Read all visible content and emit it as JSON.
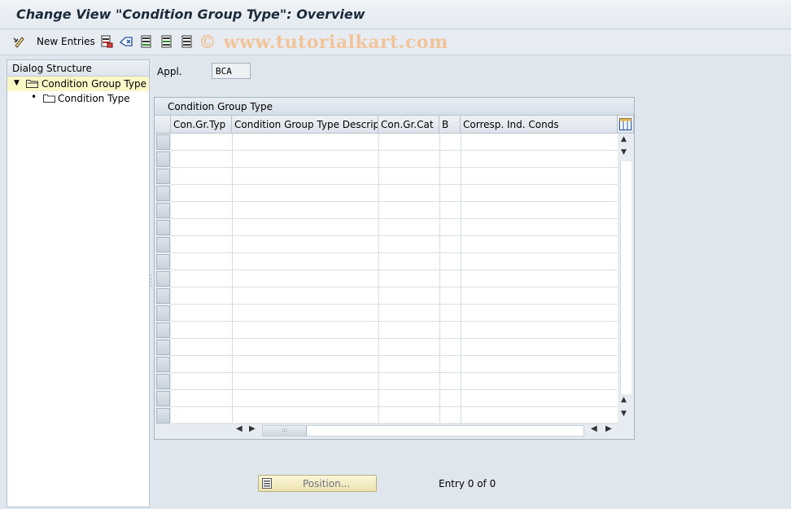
{
  "window": {
    "title": "Change View \"Condition Group Type\": Overview"
  },
  "toolbar": {
    "new_entries_label": "New Entries",
    "watermark": "© www.tutorialkart.com",
    "icons": [
      "change-display-icon",
      "new-entries-icon",
      "copy-as-icon",
      "delete-icon",
      "undo-change-icon",
      "select-all-icon",
      "select-block-icon",
      "deselect-all-icon"
    ]
  },
  "dialog_structure": {
    "header": "Dialog Structure",
    "items": [
      {
        "label": "Condition Group Type",
        "selected": true,
        "expanded": true,
        "level": 0
      },
      {
        "label": "Condition Type",
        "selected": false,
        "level": 1
      }
    ]
  },
  "filter": {
    "appl_label": "Appl.",
    "appl_value": "BCA"
  },
  "table": {
    "title": "Condition Group Type",
    "columns": [
      "Con.Gr.Typ",
      "Condition Group Type Descrip...",
      "Con.Gr.Cat",
      "B",
      "Corresp. Ind. Conds"
    ],
    "rows": [],
    "empty_row_count": 17
  },
  "footer": {
    "position_button_label": "Position...",
    "entry_text": "Entry 0 of 0"
  },
  "colors": {
    "background": "#dfe6ee",
    "selected_tree_item": "#fbf8c8",
    "position_button": "#f4ecc2"
  }
}
